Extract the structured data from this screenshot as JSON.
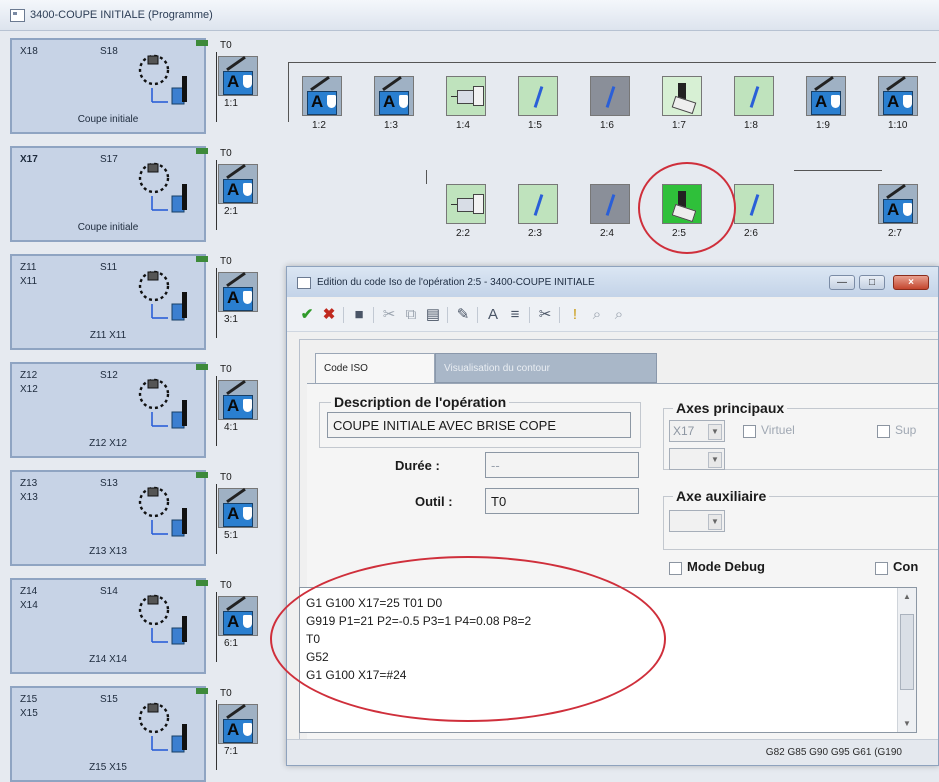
{
  "window": {
    "title": "3400-COUPE INITIALE (Programme)"
  },
  "axes": [
    {
      "name": "X18",
      "sub": "",
      "slot": "S18",
      "caption": "Coupe initiale",
      "t0": "T0",
      "bold": false
    },
    {
      "name": "X17",
      "sub": "",
      "slot": "S17",
      "caption": "Coupe initiale",
      "t0": "T0",
      "bold": true
    },
    {
      "name": "Z11",
      "sub": "X11",
      "slot": "S11",
      "caption": "Z11 X11",
      "t0": "T0",
      "bold": false
    },
    {
      "name": "Z12",
      "sub": "X12",
      "slot": "S12",
      "caption": "Z12 X12",
      "t0": "T0",
      "bold": false
    },
    {
      "name": "Z13",
      "sub": "X13",
      "slot": "S13",
      "caption": "Z13 X13",
      "t0": "T0",
      "bold": false
    },
    {
      "name": "Z14",
      "sub": "X14",
      "slot": "S14",
      "caption": "Z14 X14",
      "t0": "T0",
      "bold": false
    },
    {
      "name": "Z15",
      "sub": "X15",
      "slot": "S15",
      "caption": "Z15 X15",
      "t0": "T0",
      "bold": false
    }
  ],
  "row_labels": [
    "1:1",
    "2:1",
    "3:1",
    "4:1",
    "5:1",
    "6:1",
    "7:1"
  ],
  "row1_ops": [
    {
      "label": "1:2",
      "kind": "tool",
      "letter": "A"
    },
    {
      "label": "1:3",
      "kind": "tool",
      "letter": "A"
    },
    {
      "label": "1:4",
      "kind": "move"
    },
    {
      "label": "1:5",
      "kind": "plain"
    },
    {
      "label": "1:6",
      "kind": "grey"
    },
    {
      "label": "1:7",
      "kind": "cut"
    },
    {
      "label": "1:8",
      "kind": "plain"
    },
    {
      "label": "1:9",
      "kind": "tool",
      "letter": "A"
    },
    {
      "label": "1:10",
      "kind": "tool",
      "letter": "A"
    }
  ],
  "row2_ops": [
    {
      "label": "2:2",
      "kind": "move"
    },
    {
      "label": "2:3",
      "kind": "plain"
    },
    {
      "label": "2:4",
      "kind": "grey"
    },
    {
      "label": "2:5",
      "kind": "cut",
      "selected": true
    },
    {
      "label": "2:6",
      "kind": "plain"
    },
    {
      "label": "2:7",
      "kind": "tool",
      "letter": "A"
    }
  ],
  "dialog": {
    "title": "Edition du code Iso de l'opération 2:5 - 3400-COUPE INITIALE",
    "window_buttons": {
      "minimize": "—",
      "maximize": "□",
      "close": "×"
    },
    "toolbar": {
      "validate": "✔",
      "cancel": "✖",
      "save": "■",
      "cut": "✂",
      "copy": "⧉",
      "paste": "▤",
      "tool": "✎",
      "font": "A",
      "format": "≡",
      "clean": "✂",
      "note": "!",
      "find": "⌕",
      "find_next": "⌕"
    },
    "tabs": {
      "active": "Code ISO",
      "inactive": "Visualisation du contour"
    },
    "description_title": "Description de l'opération",
    "description_value": "COUPE INITIALE AVEC BRISE COPE",
    "duree_label": "Durée :",
    "duree_value": "--",
    "outil_label": "Outil :",
    "outil_value": "T0",
    "axes_title": "Axes principaux",
    "axes_combo": "X17",
    "axes_combo2": "",
    "virtuel_label": "Virtuel",
    "sup_label": "Sup",
    "aux_title": "Axe auxiliaire",
    "aux_combo": "",
    "debug_label": "Mode Debug",
    "con_label": "Con",
    "code_lines": [
      "G1 G100 X17=25 T01 D0",
      "G919 P1=21 P2=-0.5 P3=1 P4=0.08 P8=2",
      "T0",
      "G52",
      "G1 G100 X17=#24"
    ],
    "status": "G82 G85 G90 G95 G61 (G190"
  },
  "colors": {
    "panel": "#c7d3e6",
    "selected_tile": "#2fc03a",
    "annotation": "#cf2f3b",
    "tool_blue": "#2a7fd0"
  }
}
